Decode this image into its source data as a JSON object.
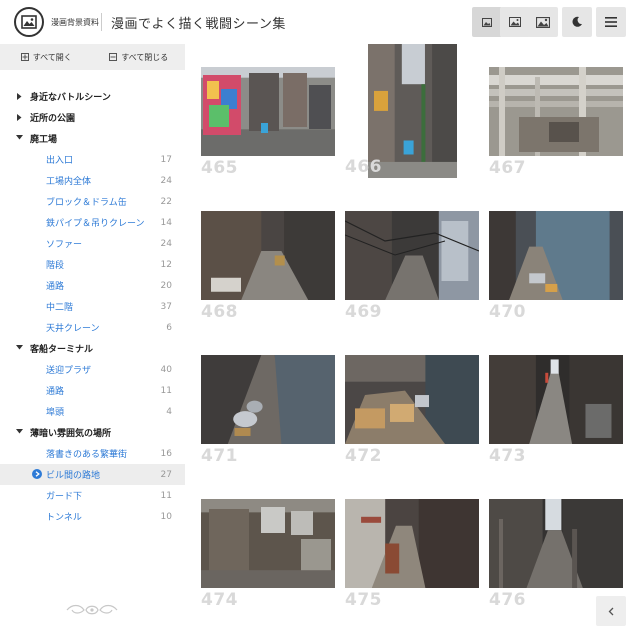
{
  "header": {
    "brand": "漫画背景資料",
    "title": "漫画でよく描く戦闘シーン集",
    "buttons": [
      {
        "name": "view-small-button",
        "icon": "image-small-icon"
      },
      {
        "name": "view-medium-button",
        "icon": "image-medium-icon"
      },
      {
        "name": "view-large-button",
        "icon": "image-large-icon"
      },
      {
        "name": "dark-mode-button",
        "icon": "moon-icon"
      },
      {
        "name": "menu-button",
        "icon": "hamburger-icon"
      }
    ]
  },
  "sidebar": {
    "expand_all": "すべて開く",
    "collapse_all": "すべて閉じる",
    "categories": [
      {
        "label": "身近なバトルシーン",
        "expanded": false,
        "items": []
      },
      {
        "label": "近所の公園",
        "expanded": false,
        "items": []
      },
      {
        "label": "廃工場",
        "expanded": true,
        "items": [
          {
            "label": "出入口",
            "count": "17"
          },
          {
            "label": "工場内全体",
            "count": "24"
          },
          {
            "label": "ブロック＆ドラム缶",
            "count": "22"
          },
          {
            "label": "鉄パイプ＆吊りクレーン",
            "count": "14"
          },
          {
            "label": "ソファー",
            "count": "24"
          },
          {
            "label": "階段",
            "count": "12"
          },
          {
            "label": "通路",
            "count": "20"
          },
          {
            "label": "中二階",
            "count": "37"
          },
          {
            "label": "天井クレーン",
            "count": "6"
          }
        ]
      },
      {
        "label": "客船ターミナル",
        "expanded": true,
        "items": [
          {
            "label": "送迎プラザ",
            "count": "40"
          },
          {
            "label": "通路",
            "count": "11"
          },
          {
            "label": "埠頭",
            "count": "4"
          }
        ]
      },
      {
        "label": "薄暗い雰囲気の場所",
        "expanded": true,
        "items": [
          {
            "label": "落書きのある繁華街",
            "count": "16"
          },
          {
            "label": "ビル間の路地",
            "count": "27",
            "selected": true
          },
          {
            "label": "ガード下",
            "count": "11"
          },
          {
            "label": "トンネル",
            "count": "10"
          }
        ]
      }
    ]
  },
  "gallery": {
    "photos": [
      {
        "number": "465",
        "desc": "graffiti-street"
      },
      {
        "number": "466",
        "desc": "narrow-alley-portrait"
      },
      {
        "number": "467",
        "desc": "pipes-wall"
      },
      {
        "number": "468",
        "desc": "alley-trash"
      },
      {
        "number": "469",
        "desc": "alley-wires"
      },
      {
        "number": "470",
        "desc": "alley-blue-wall"
      },
      {
        "number": "471",
        "desc": "trash-corridor"
      },
      {
        "number": "472",
        "desc": "cardboard-trash"
      },
      {
        "number": "473",
        "desc": "long-alley"
      },
      {
        "number": "474",
        "desc": "ac-units-wall"
      },
      {
        "number": "475",
        "desc": "rusty-alley"
      },
      {
        "number": "476",
        "desc": "dark-alley"
      }
    ]
  },
  "colors": {
    "accent": "#2d7ad6",
    "number": "#d9d9d9"
  },
  "footer": {
    "collapse_icon": "chevron-left-icon"
  }
}
